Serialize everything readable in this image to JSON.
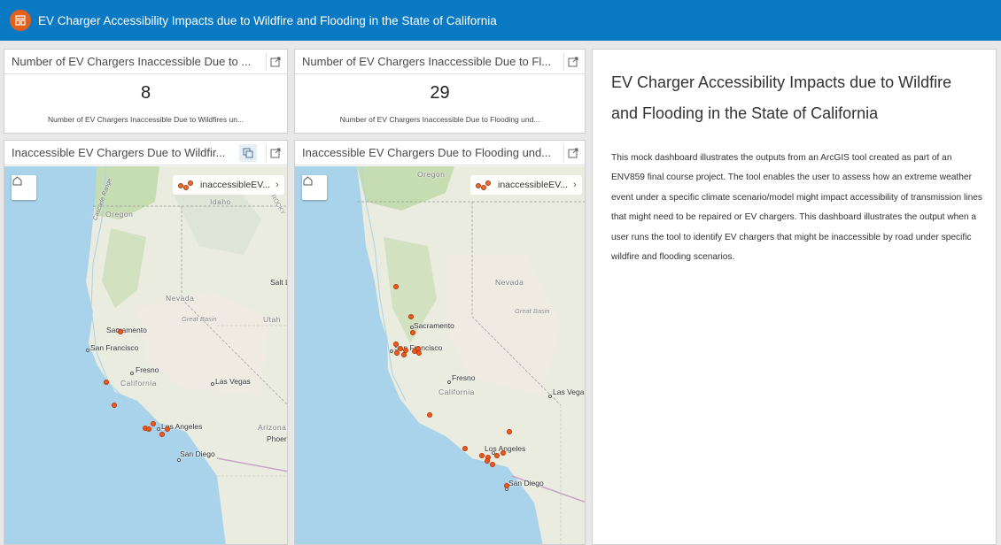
{
  "header": {
    "title": "EV Charger Accessibility Impacts due to Wildfire and Flooding in the State of California"
  },
  "indicators": [
    {
      "title": "Number of EV Chargers Inaccessible Due to ...",
      "value": "8",
      "description": "Number of EV Chargers Inaccessible Due to Wildfires un..."
    },
    {
      "title": "Number of EV Chargers Inaccessible Due to Fl...",
      "value": "29",
      "description": "Number of EV Chargers Inaccessible Due to Flooding und..."
    }
  ],
  "maps": [
    {
      "title": "Inaccessible EV Chargers Due to Wildfir...",
      "legend": "inaccessibleEV...",
      "labels": {
        "oregon": "Oregon",
        "idaho": "Idaho",
        "nevada": "Nevada",
        "utah": "Utah",
        "great_basin": "Great Basin",
        "sacramento": "Sacramento",
        "san_francisco": "San Francisco",
        "fresno": "Fresno",
        "california": "California",
        "las_vegas": "Las Vegas",
        "los_angeles": "Los Angeles",
        "san_diego": "San Diego",
        "arizona": "Arizona",
        "phoenix": "Phoer",
        "salt_lake": "Salt L",
        "cascade": "Cascade Range",
        "rocky": "ROCKY"
      }
    },
    {
      "title": "Inaccessible EV Chargers Due to Flooding und...",
      "legend": "inaccessibleEV...",
      "labels": {
        "oregon": "Oregon",
        "nevada": "Nevada",
        "great_basin": "Great Basin",
        "sacramento": "Sacramento",
        "san_francisco": "San Francisco",
        "fresno": "Fresno",
        "california": "California",
        "las_vegas": "Las Vega",
        "los_angeles": "Los Angeles",
        "san_diego": "San Diego"
      }
    }
  ],
  "text_panel": {
    "title": "EV Charger Accessibility Impacts due to Wildfire and Flooding in the State of California",
    "body": "This mock dashboard illustrates the outputs from an ArcGIS tool created as part of an ENV859 final course project. The tool enables the user to assess how an extreme weather event under a specific climate scenario/model might impact accessibility of transmission lines that might need to be repaired or EV chargers. This dashboard illustrates the output when a user runs the tool to identify EV chargers that might be inaccessible by road under specific wildfire and flooding scenarios."
  },
  "colors": {
    "header_bg": "#0a79c4",
    "logo_bg": "#e2621b",
    "point_fill": "#f25a1c"
  },
  "icons": {
    "logo": "dashboard-logo-icon",
    "export": "export-icon",
    "layers": "layers-icon",
    "home": "home-icon",
    "chevron": "chevron-right-icon"
  }
}
